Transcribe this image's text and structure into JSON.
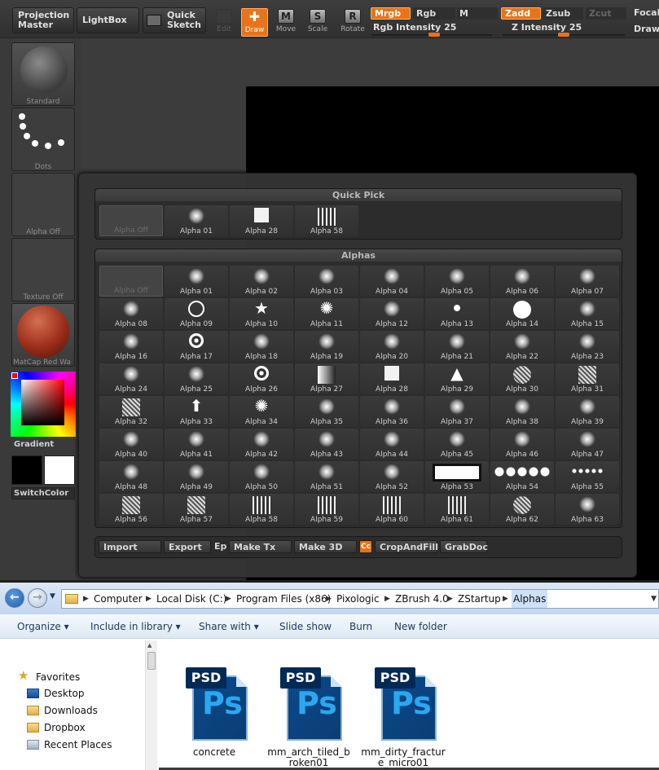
{
  "toolbar": {
    "projection_master": "Projection Master",
    "projection_master_l1": "Projection",
    "projection_master_l2": "Master",
    "lightbox": "LightBox",
    "quick_sketch_l1": "Quick",
    "quick_sketch_l2": "Sketch",
    "tools": [
      {
        "label": "Edit",
        "glyph": ""
      },
      {
        "label": "Draw",
        "glyph": "✚"
      },
      {
        "label": "Move",
        "glyph": "M"
      },
      {
        "label": "Scale",
        "glyph": "S"
      },
      {
        "label": "Rotate",
        "glyph": "R"
      }
    ],
    "modes": {
      "mrgb": "Mrgb",
      "rgb": "Rgb",
      "m": "M",
      "zadd": "Zadd",
      "zsub": "Zsub",
      "zcut": "Zcut",
      "focal": "Focal",
      "draw": "Draw"
    },
    "rgb_intensity": "Rgb Intensity 25",
    "z_intensity": "Z Intensity 25",
    "rgb_intensity_value": 25,
    "z_intensity_value": 25
  },
  "left_tray": {
    "brush_label": "Standard",
    "stroke_label": "Dots",
    "alpha_label": "Alpha Off",
    "texture_label": "Texture Off",
    "material_label": "MatCap Red Wa",
    "gradient_label": "Gradient",
    "switch_color_label": "SwitchColor"
  },
  "popup": {
    "quick_pick_title": "Quick Pick",
    "quick_pick": [
      "Alpha Off",
      "Alpha 01",
      "Alpha 28",
      "Alpha 58"
    ],
    "alphas_title": "Alphas",
    "alphas": [
      "Alpha Off",
      "Alpha 01",
      "Alpha 02",
      "Alpha 03",
      "Alpha 04",
      "Alpha 05",
      "Alpha 06",
      "Alpha 07",
      "Alpha 08",
      "Alpha 09",
      "Alpha 10",
      "Alpha 11",
      "Alpha 12",
      "Alpha 13",
      "Alpha 14",
      "Alpha 15",
      "Alpha 16",
      "Alpha 17",
      "Alpha 18",
      "Alpha 19",
      "Alpha 20",
      "Alpha 21",
      "Alpha 22",
      "Alpha 23",
      "Alpha 24",
      "Alpha 25",
      "Alpha 26",
      "Alpha 27",
      "Alpha 28",
      "Alpha 29",
      "Alpha 30",
      "Alpha 31",
      "Alpha 32",
      "Alpha 33",
      "Alpha 34",
      "Alpha 35",
      "Alpha 36",
      "Alpha 37",
      "Alpha 38",
      "Alpha 39",
      "Alpha 40",
      "Alpha 41",
      "Alpha 42",
      "Alpha 43",
      "Alpha 44",
      "Alpha 45",
      "Alpha 46",
      "Alpha 47",
      "Alpha 48",
      "Alpha 49",
      "Alpha 50",
      "Alpha 51",
      "Alpha 52",
      "Alpha 53",
      "Alpha 54",
      "Alpha 55",
      "Alpha 56",
      "Alpha 57",
      "Alpha 58",
      "Alpha 59",
      "Alpha 60",
      "Alpha 61",
      "Alpha 62",
      "Alpha 63"
    ],
    "buttons": {
      "import": "Import",
      "export": "Export",
      "ep": "Ep",
      "make_tx": "Make Tx",
      "make_3d": "Make 3D",
      "cc": "Cc",
      "crop_and_fill": "CropAndFill",
      "grab_doc": "GrabDoc"
    }
  },
  "explorer": {
    "breadcrumbs": [
      "Computer",
      "Local Disk (C:)",
      "Program Files (x86)",
      "Pixologic",
      "ZBrush 4.0",
      "ZStartup",
      "Alphas"
    ],
    "commands": [
      "Organize",
      "Include in library",
      "Share with",
      "Slide show",
      "Burn",
      "New folder"
    ],
    "favorites_title": "Favorites",
    "sidebar": [
      "Desktop",
      "Downloads",
      "Dropbox",
      "Recent Places"
    ],
    "file_badge": "PSD",
    "file_mark": "Ps",
    "files": [
      {
        "name": "concrete"
      },
      {
        "name": "mm_arch_tiled_broken01",
        "l1": "mm_arch_tiled_b",
        "l2": "roken01"
      },
      {
        "name": "mm_dirty_fracture_micro01",
        "l1": "mm_dirty_fractur",
        "l2": "e_micro01"
      }
    ]
  },
  "colors": {
    "accent_orange": "#e8741a",
    "explorer_blue": "#1e395b"
  }
}
